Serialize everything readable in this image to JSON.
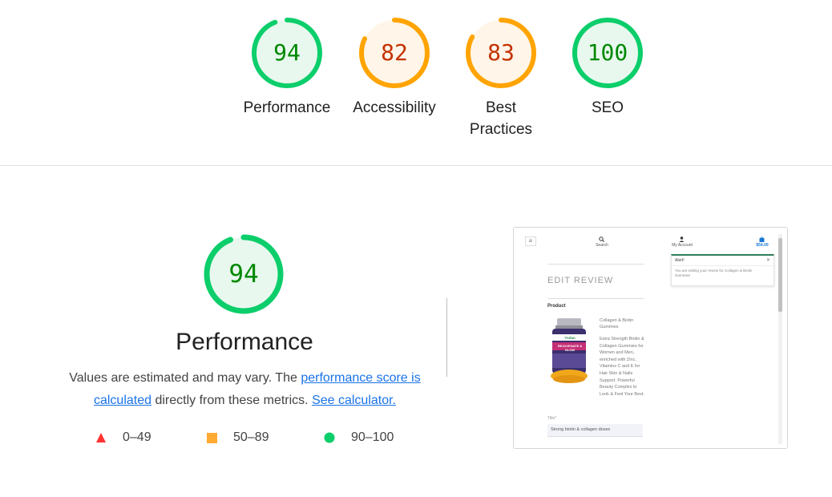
{
  "gauges": [
    {
      "score": "94",
      "label": "Performance",
      "color": "#0cce6b",
      "text_color": "#008800",
      "fill": "#e8f8ee",
      "fraction": 0.94
    },
    {
      "score": "82",
      "label": "Accessibility",
      "color": "#ffa400",
      "text_color": "#c33300",
      "fill": "#fff5e8",
      "fraction": 0.82
    },
    {
      "score": "83",
      "label_line1": "Best",
      "label_line2": "Practices",
      "color": "#ffa400",
      "text_color": "#c33300",
      "fill": "#fff5e8",
      "fraction": 0.83
    },
    {
      "score": "100",
      "label": "SEO",
      "color": "#0cce6b",
      "text_color": "#008800",
      "fill": "#e8f8ee",
      "fraction": 1.0
    }
  ],
  "performance": {
    "score": "94",
    "fraction": 0.94,
    "title": "Performance",
    "desc_prefix": "Values are estimated and may vary. The ",
    "link_score": "performance score is calculated",
    "desc_middle": " directly from these metrics. ",
    "link_calc": "See calculator."
  },
  "legend": [
    {
      "shape": "triangle",
      "range": "0–49",
      "color": "#ff3333"
    },
    {
      "shape": "square",
      "range": "50–89",
      "color": "#ffaa33"
    },
    {
      "shape": "circle",
      "range": "90–100",
      "color": "#0cce6b"
    }
  ],
  "thumbnail": {
    "search_label": "Search",
    "account_label": "My Account",
    "cart_price": "$54.00",
    "alert_title": "Alert!",
    "alert_close": "✕",
    "alert_message": "You are editing your review for Collagen & Biotin Gummies",
    "heading": "EDIT REVIEW",
    "product_label": "Product",
    "product_name": "Collagen & Biotin Gummies",
    "product_description": "Extra Strength Biotin & Collagen Gummies for Women and Men, enriched with Zinc, Vitamins C and E for Hair Skin & Nails Support. Powerful Beauty Complex to Look & Feel Your Best.",
    "bottle_brand": "Yodan",
    "bottle_text": "REJUVENATE & GLOW",
    "title_label": "Title*",
    "title_value": "Strong biotin & collagen doses",
    "menu_icon": "≡"
  }
}
